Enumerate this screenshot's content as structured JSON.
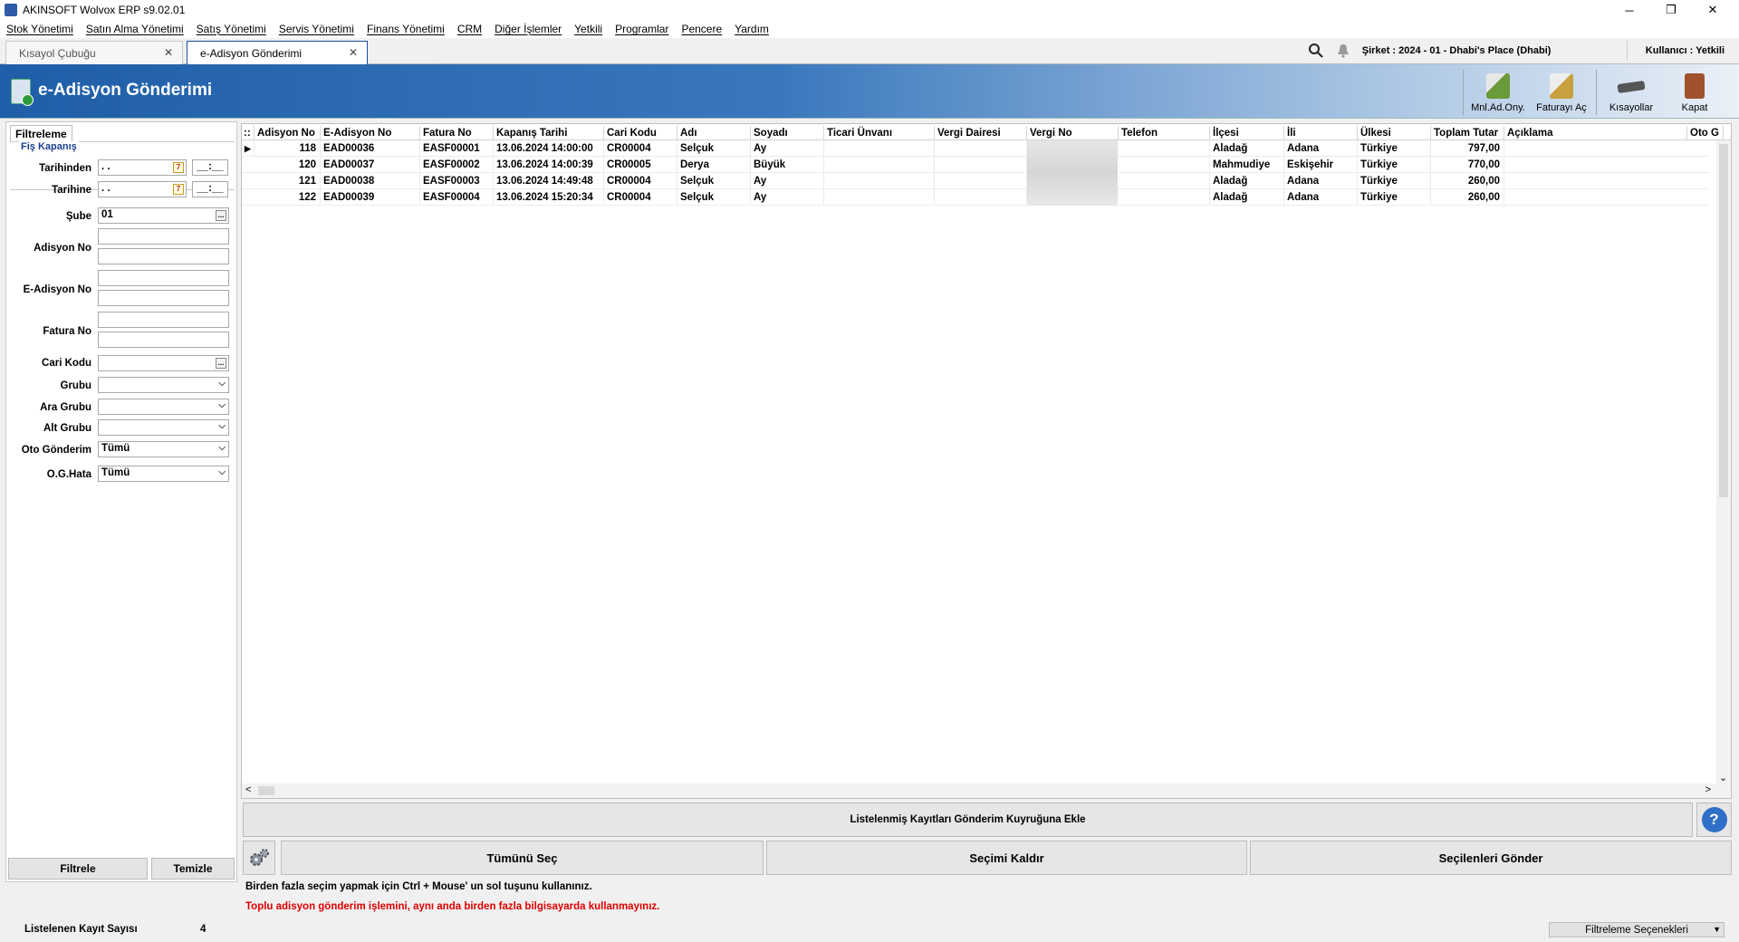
{
  "window": {
    "title": "AKINSOFT Wolvox ERP s9.02.01",
    "minimize": "─",
    "restore": "❐",
    "close": "✕"
  },
  "menu": [
    "Stok Yönetimi",
    "Satın Alma Yönetimi",
    "Satış Yönetimi",
    "Servis Yönetimi",
    "Finans Yönetimi",
    "CRM",
    "Diğer İşlemler",
    "Yetkili",
    "Programlar",
    "Pencere",
    "Yardım"
  ],
  "tabs": [
    {
      "label": "Kısayol Çubuğu",
      "active": false
    },
    {
      "label": "e-Adisyon Gönderimi",
      "active": true
    }
  ],
  "tab_close": "✕",
  "topinfo": {
    "company": "Şirket : 2024 - 01 - Dhabi's Place (Dhabi)",
    "user": "Kullanıcı : Yetkili"
  },
  "page": {
    "title": "e-Adisyon Gönderimi"
  },
  "toolbar": [
    {
      "label": "Mnl.Ad.Ony.",
      "icon": "manual-approve-icon",
      "color": "#6a9a3a"
    },
    {
      "label": "Faturayı Aç",
      "icon": "open-invoice-icon",
      "color": "#c8a040"
    },
    {
      "label": "Kısayollar",
      "icon": "shortcuts-icon",
      "color": "#555555"
    },
    {
      "label": "Kapat",
      "icon": "close-door-icon",
      "color": "#a0522d"
    }
  ],
  "filter": {
    "tab": "Filtreleme",
    "group": "Fiş Kapanış",
    "from_label": "Tarihinden",
    "from_value": " .  .",
    "from_time": "__:__",
    "to_label": "Tarihine",
    "to_value": " .  .",
    "to_time": "__:__",
    "calendar_glyph": "7",
    "branch_label": "Şube",
    "branch_value": "01",
    "adisyon_label": "Adisyon No",
    "eadisyon_label": "E-Adisyon No",
    "fatura_label": "Fatura No",
    "cari_label": "Cari Kodu",
    "grubu_label": "Grubu",
    "ara_grubu_label": "Ara Grubu",
    "alt_grubu_label": "Alt Grubu",
    "oto_label": "Oto Gönderim",
    "oto_value": "Tümü",
    "og_label": "O.G.Hata",
    "og_value": "Tümü",
    "ellipsis": "...",
    "chevron": "⌵",
    "filter_btn": "Filtrele",
    "clear_btn": "Temizle"
  },
  "grid": {
    "corner": "::",
    "columns": [
      "Adisyon No",
      "E-Adisyon No",
      "Fatura No",
      "Kapanış Tarihi",
      "Cari Kodu",
      "Adı",
      "Soyadı",
      "Ticari Ünvanı",
      "Vergi Dairesi",
      "Vergi No",
      "Telefon",
      "İlçesi",
      "İli",
      "Ülkesi",
      "Toplam Tutar",
      "Açıklama",
      "Oto G"
    ],
    "row_marker": "▶",
    "rows": [
      {
        "adisyon_no": "118",
        "e_adisyon_no": "EAD00036",
        "fatura_no": "EASF00001",
        "kapanis": "13.06.2024 14:00:00",
        "cari": "CR00004",
        "adi": "Selçuk",
        "soyadi": "Ay",
        "ilce": "Aladağ",
        "il": "Adana",
        "ulke": "Türkiye",
        "toplam": "797,00"
      },
      {
        "adisyon_no": "120",
        "e_adisyon_no": "EAD00037",
        "fatura_no": "EASF00002",
        "kapanis": "13.06.2024 14:00:39",
        "cari": "CR00005",
        "adi": "Derya",
        "soyadi": "Büyük",
        "ilce": "Mahmudiye",
        "il": "Eskişehir",
        "ulke": "Türkiye",
        "toplam": "770,00"
      },
      {
        "adisyon_no": "121",
        "e_adisyon_no": "EAD00038",
        "fatura_no": "EASF00003",
        "kapanis": "13.06.2024 14:49:48",
        "cari": "CR00004",
        "adi": "Selçuk",
        "soyadi": "Ay",
        "ilce": "Aladağ",
        "il": "Adana",
        "ulke": "Türkiye",
        "toplam": "260,00"
      },
      {
        "adisyon_no": "122",
        "e_adisyon_no": "EAD00039",
        "fatura_no": "EASF00004",
        "kapanis": "13.06.2024 15:20:34",
        "cari": "CR00004",
        "adi": "Selçuk",
        "soyadi": "Ay",
        "ilce": "Aladağ",
        "il": "Adana",
        "ulke": "Türkiye",
        "toplam": "260,00"
      }
    ],
    "scroll_left": "<",
    "scroll_right": ">",
    "scroll_down": "⌄"
  },
  "actions": {
    "queue": "Listelenmiş Kayıtları Gönderim Kuyruğuna Ekle",
    "help": "?",
    "select_all": "Tümünü Seç",
    "deselect": "Seçimi Kaldır",
    "send_selected": "Seçilenleri Gönder"
  },
  "info": {
    "hint": "Birden fazla seçim yapmak için Ctrl + Mouse' un sol tuşunu kullanınız.",
    "warning": "Toplu adisyon gönderim işlemini, aynı anda birden fazla bilgisayarda kullanmayınız.",
    "warning_color": "#e00000"
  },
  "status": {
    "count_label": "Listelenen Kayıt Sayısı",
    "count": "4",
    "filter_options": "Filtreleme Seçenekleri",
    "dropdown": "▼"
  }
}
